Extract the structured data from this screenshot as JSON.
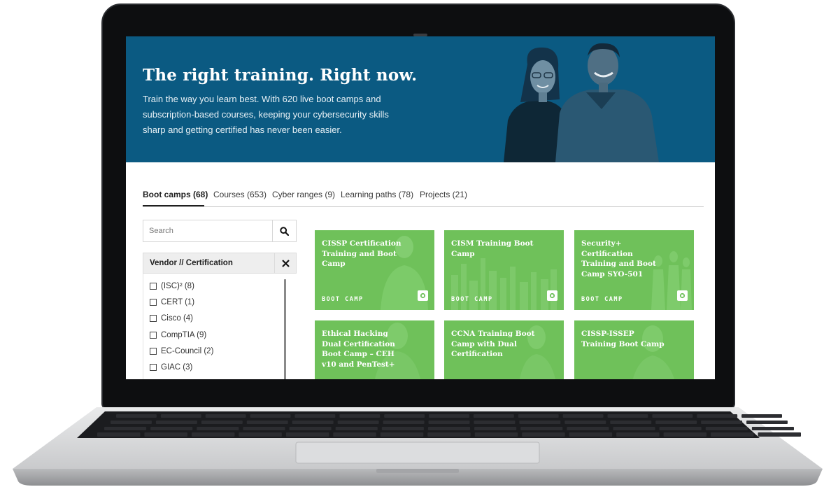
{
  "hero": {
    "title": "The right training. Right now.",
    "body": "Train the way you learn best. With 620 live boot camps and subscription-based courses, keeping your cybersecurity skills sharp and getting certified has never been easier."
  },
  "tabs": [
    {
      "label": "Boot camps (68)",
      "active": true
    },
    {
      "label": "Courses (653)"
    },
    {
      "label": "Cyber ranges (9)"
    },
    {
      "label": "Learning paths (78)"
    },
    {
      "label": "Projects (21)"
    }
  ],
  "search": {
    "placeholder": "Search"
  },
  "filter": {
    "title": "Vendor // Certification",
    "items": [
      {
        "label": "(ISC)² (8)"
      },
      {
        "label": "CERT (1)"
      },
      {
        "label": "Cisco (4)"
      },
      {
        "label": "CompTIA (9)"
      },
      {
        "label": "EC-Council (2)"
      },
      {
        "label": "GIAC (3)"
      }
    ]
  },
  "cards": [
    {
      "title": "CISSP Certification Training and Boot Camp",
      "tag": "BOOT CAMP"
    },
    {
      "title": "CISM Training Boot Camp",
      "tag": "BOOT CAMP"
    },
    {
      "title": "Security+ Certification Training and Boot Camp SYO-501",
      "tag": "BOOT CAMP"
    },
    {
      "title": "Ethical Hacking Dual Certification Boot Camp – CEH v10 and PenTest+",
      "tag": ""
    },
    {
      "title": "CCNA Training Boot Camp with Dual Certification",
      "tag": ""
    },
    {
      "title": "CISSP-ISSEP Training Boot Camp",
      "tag": ""
    }
  ],
  "colors": {
    "hero_bg": "#0b5a82",
    "card_green": "#6fc15a",
    "laptop_bezel": "#0d0e10",
    "laptop_body": "#d8d9db"
  }
}
